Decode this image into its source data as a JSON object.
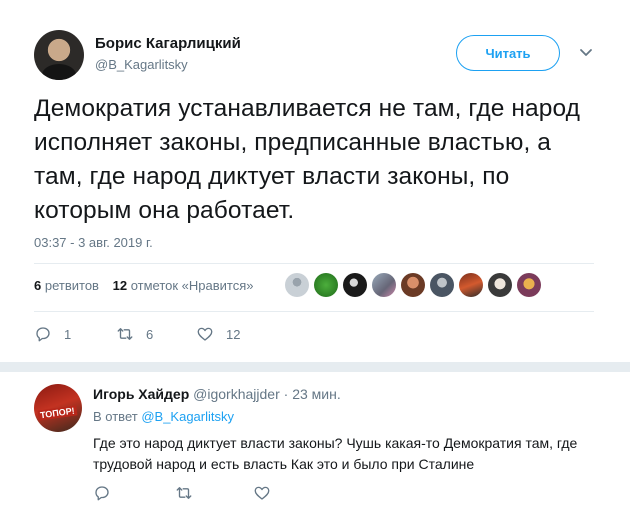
{
  "tweet": {
    "author_name": "Борис Кагарлицкий",
    "author_handle": "@B_Kagarlitsky",
    "follow_label": "Читать",
    "text": "Демократия устанавливается не там, где народ исполняет законы, предписанные властью, а там, где народ диктует власти законы, по которым она работает.",
    "timestamp": "03:37 - 3 авг. 2019 г.",
    "retweets_count": "6",
    "retweets_label": "ретвитов",
    "likes_count": "12",
    "likes_label": "отметок «Нравится»",
    "reply_count": "1",
    "retweet_action_count": "6",
    "like_action_count": "12"
  },
  "reply": {
    "author_name": "Игорь Хайдер",
    "author_handle": "@igorkhajjder",
    "time": "· 23 мин.",
    "reply_to_prefix": "В ответ",
    "reply_to_handle": "@B_Kagarlitsky",
    "text": "Где это народ диктует власти законы? Чушь какая-то Демократия там, где трудовой народ и есть власть Как это и было при Сталине",
    "avatar_badge": "ТОПОР!"
  },
  "colors": {
    "accent": "#1da1f2",
    "secondary_text": "#657786",
    "primary_text": "#14171a",
    "divider": "#e6ecf0"
  },
  "icons": [
    "chevron-down-icon",
    "reply-icon",
    "retweet-icon",
    "like-icon"
  ]
}
